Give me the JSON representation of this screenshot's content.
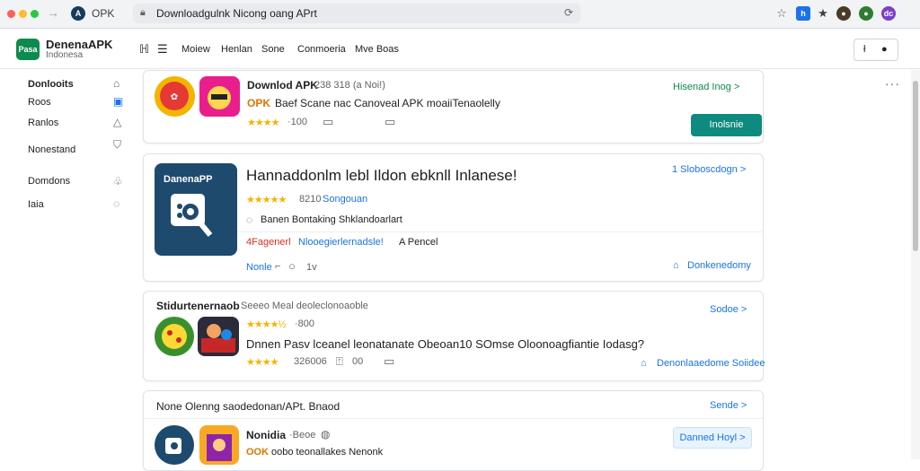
{
  "browser": {
    "tab_title": "OPK",
    "tab_icon": "apk-site-icon",
    "url": "Downloadgulnk Nicong oang APrt",
    "icons": [
      "back-icon",
      "forward-icon",
      "lock-icon",
      "reload-icon",
      "bookmark-icon",
      "extension-icon",
      "star-icon",
      "profile-icon"
    ]
  },
  "header": {
    "brand_logo_text": "Pasa",
    "brand_name": "DenenaAPK",
    "brand_sub": "Indonesa",
    "nav": [
      "Moiew",
      "Henlan",
      "Sone",
      "Conmoeria",
      "Mve Boas"
    ],
    "right_btn_left": "ł",
    "right_btn_right": "●"
  },
  "sidebar": {
    "items": [
      {
        "label": "Donlooits",
        "active": true
      },
      {
        "label": "Roos",
        "active": false
      },
      {
        "label": "Ranlos",
        "active": false
      },
      {
        "label": "Nonestand",
        "active": false
      },
      {
        "label": "Domdons",
        "active": false
      },
      {
        "label": "Iaia",
        "active": false
      }
    ]
  },
  "card1": {
    "title": "Downlod APK",
    "meta": "238 318 (a Noi!)",
    "tag": "OPK",
    "subtitle": "Baef Scane nac Canoveal APK moaiiTenaolelly",
    "rating_count": "·100",
    "link": "Hisenad Inog >",
    "install": "Inolsnie"
  },
  "card2": {
    "badge": "DanenaPP",
    "title": "Hannaddonlm lebl Ildon ebknll Inlanese!",
    "rating": "8210",
    "rating_link": "Songouan",
    "desc": "Banen Bontaking Shklandoarlart",
    "tag_red": "4Fagenerl",
    "tag_blue": "Nlooegierlernadsle!",
    "tag_plain": "A Pencel",
    "footer_link": "Nonle",
    "footer_count": "1v",
    "top_link": "1 Sloboscdogn >",
    "bottom_right": "Donkenedomy"
  },
  "card3": {
    "title": "Stidurtenernaob",
    "title_tail": "Seeeo Meal deoleclonoaoble",
    "rating": "·800",
    "subtitle": "Dnnen Pasv lceanel leonatanate Obeoan10 SOmse Oloonoagfiantie Iodasg?",
    "count2": "326006",
    "count3": "00",
    "top_link": "Sodoe >",
    "bottom_link": "Denonlaaedome Soiidee"
  },
  "card4": {
    "title": "None Olenng saodedonan/APt. Bnaod",
    "top_link": "Sende >",
    "app_name": "Nonidia",
    "app_meta": "·Beoe",
    "app_tag": "OOK",
    "app_sub": "oobo teonallakes Nenonk",
    "pill": "Danned Hoyl >"
  }
}
